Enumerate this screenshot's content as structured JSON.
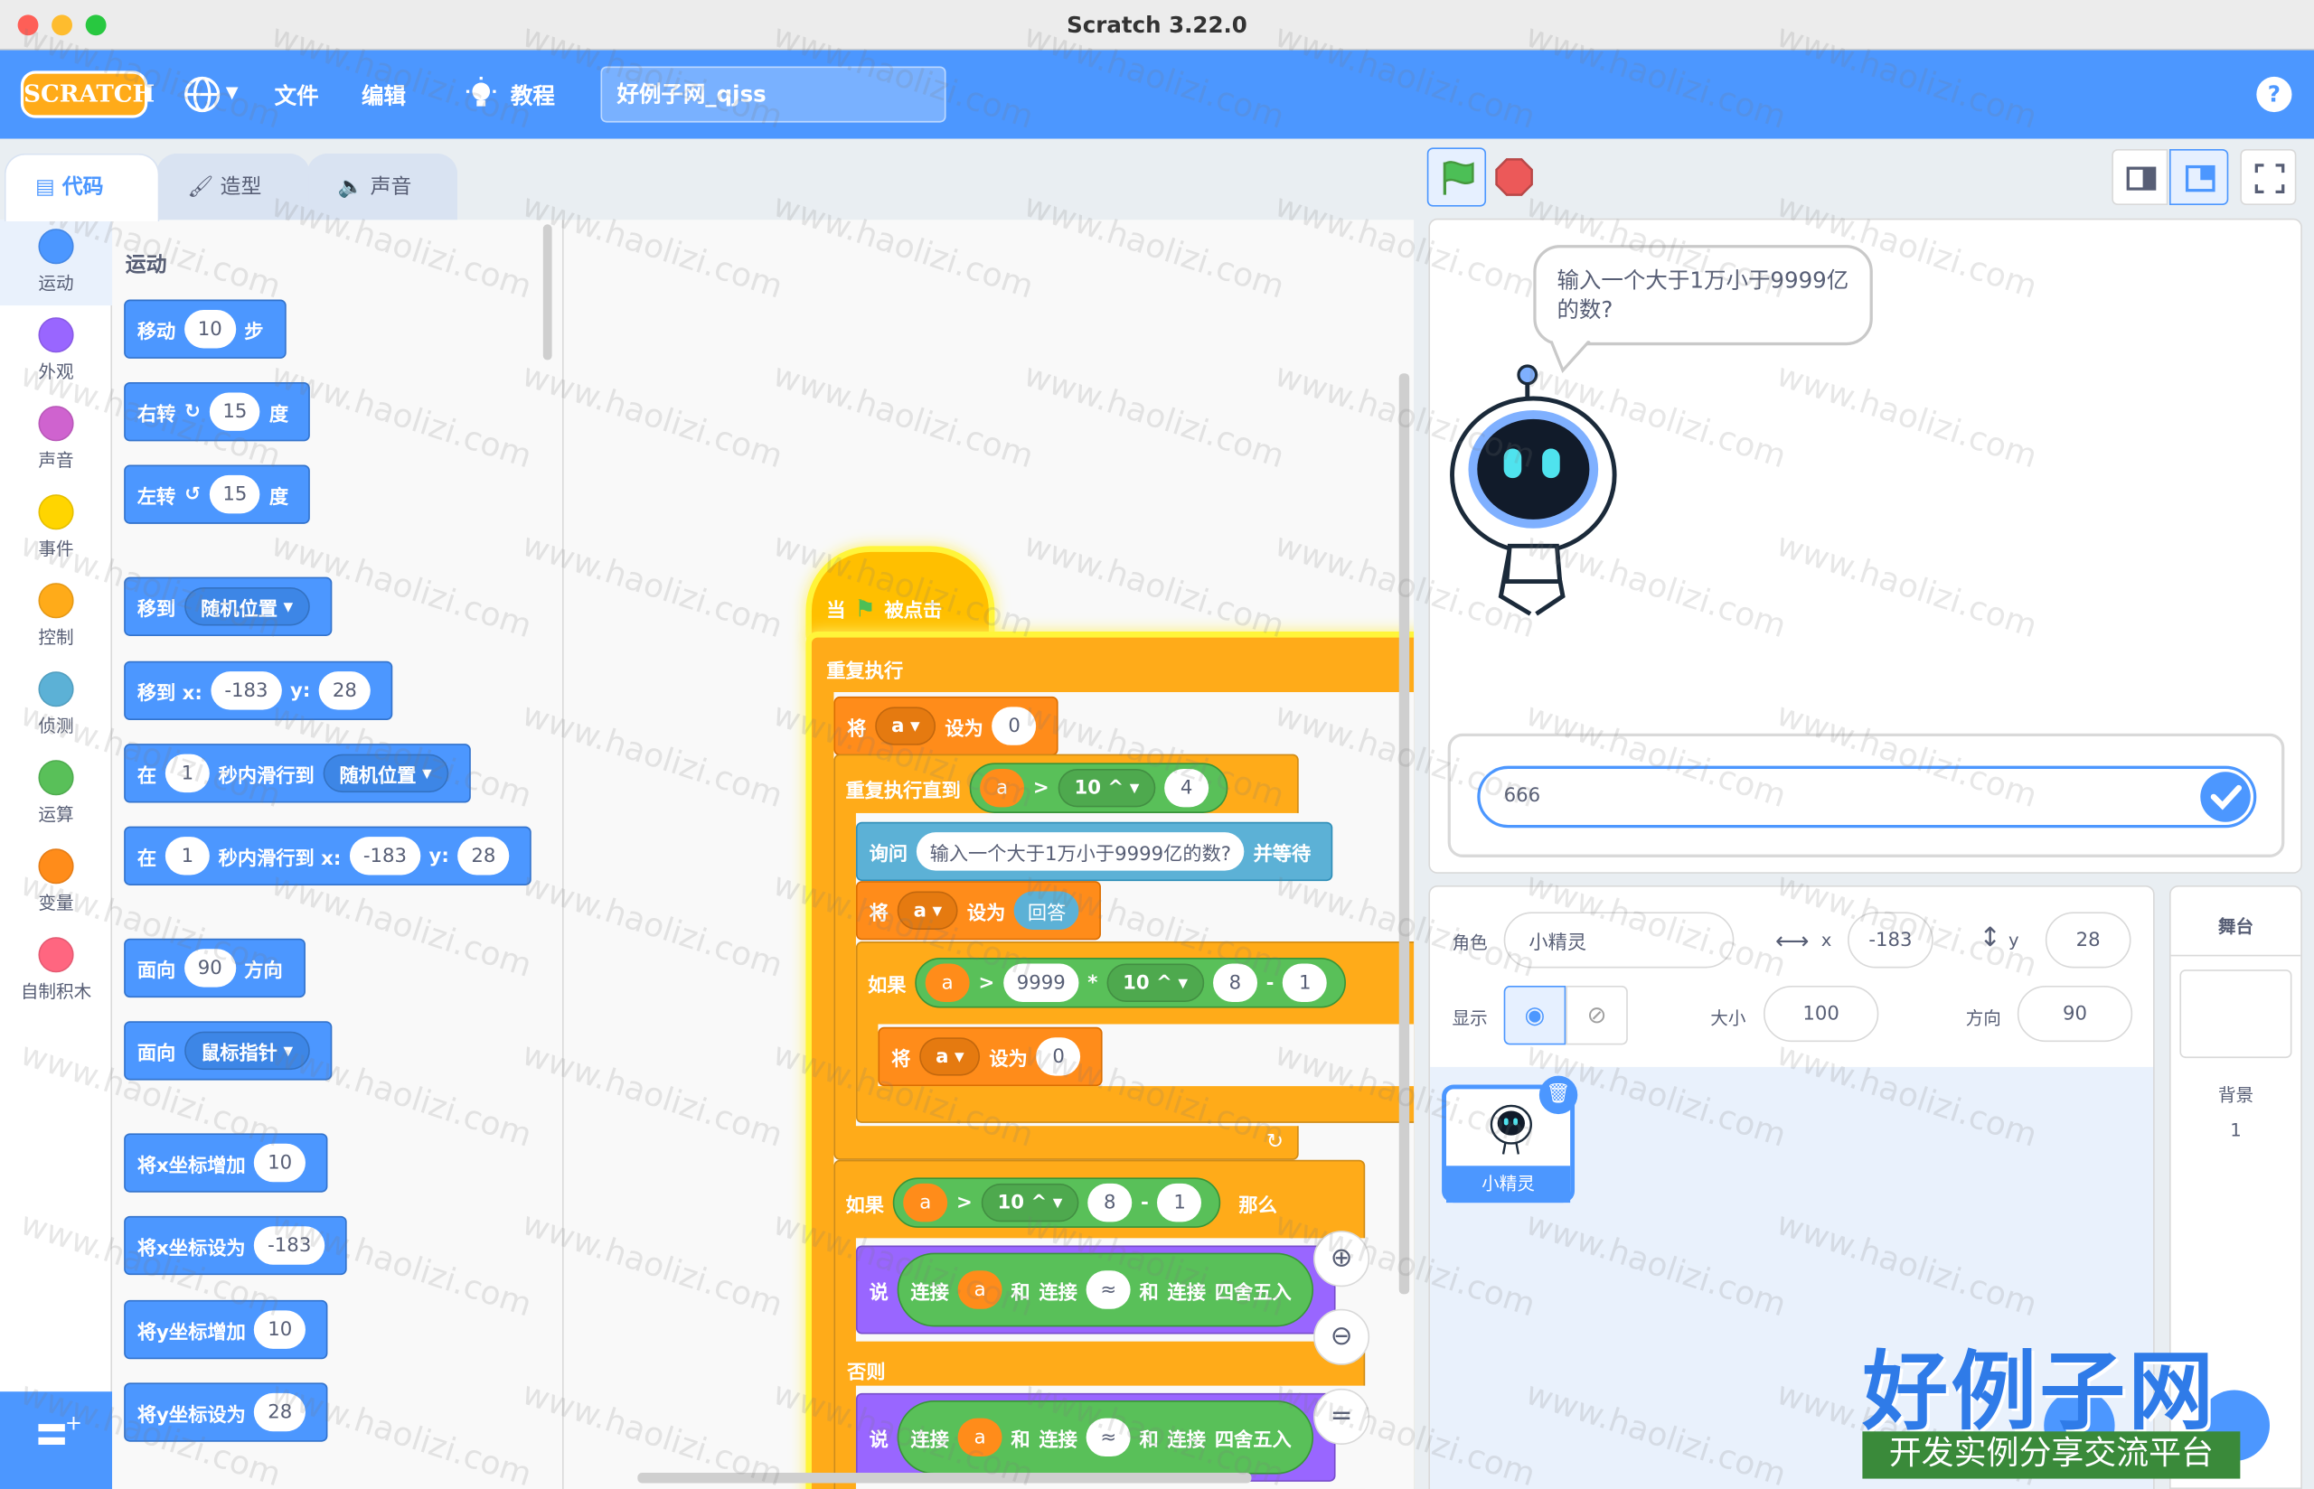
{
  "window": {
    "title": "Scratch 3.22.0"
  },
  "menubar": {
    "logo": "SCRATCH",
    "language_icon": "globe-icon",
    "file": "文件",
    "edit": "编辑",
    "tutorials": "教程",
    "project_name": "好例子网_qjss",
    "help": "?"
  },
  "tabs": [
    {
      "label": "代码",
      "active": true
    },
    {
      "label": "造型",
      "active": false
    },
    {
      "label": "声音",
      "active": false
    }
  ],
  "categories": [
    {
      "label": "运动",
      "color": "#4c97ff"
    },
    {
      "label": "外观",
      "color": "#9966ff"
    },
    {
      "label": "声音",
      "color": "#cf63cf"
    },
    {
      "label": "事件",
      "color": "#ffd500"
    },
    {
      "label": "控制",
      "color": "#ffab19"
    },
    {
      "label": "侦测",
      "color": "#5cb1d6"
    },
    {
      "label": "运算",
      "color": "#59c059"
    },
    {
      "label": "变量",
      "color": "#ff8c1a"
    },
    {
      "label": "自制积木",
      "color": "#ff6680"
    }
  ],
  "palette": {
    "heading": "运动",
    "move": {
      "a": "移动",
      "v": "10",
      "b": "步"
    },
    "turn_right": {
      "a": "右转",
      "v": "15",
      "b": "度"
    },
    "turn_left": {
      "a": "左转",
      "v": "15",
      "b": "度"
    },
    "goto": {
      "a": "移到",
      "v": "随机位置"
    },
    "goto_xy": {
      "a": "移到 x:",
      "x": "-183",
      "b": "y:",
      "y": "28"
    },
    "glide": {
      "a": "在",
      "v": "1",
      "b": "秒内滑行到",
      "d": "随机位置"
    },
    "glide_xy": {
      "a": "在",
      "v": "1",
      "b": "秒内滑行到 x:",
      "x": "-183",
      "c": "y:",
      "y": "28"
    },
    "point_dir": {
      "a": "面向",
      "v": "90",
      "b": "方向"
    },
    "point_towards": {
      "a": "面向",
      "v": "鼠标指针"
    },
    "change_x": {
      "a": "将x坐标增加",
      "v": "10"
    },
    "set_x": {
      "a": "将x坐标设为",
      "v": "-183"
    },
    "change_y": {
      "a": "将y坐标增加",
      "v": "10"
    },
    "set_y": {
      "a": "将y坐标设为",
      "v": "28"
    }
  },
  "script": {
    "hat": {
      "a": "当",
      "b": "被点击"
    },
    "forever": "重复执行",
    "set1": {
      "a": "将",
      "var": "a",
      "b": "设为",
      "v": "0"
    },
    "repeat_until": {
      "a": "重复执行直到",
      "var": "a",
      "op": ">",
      "p": "10 ^",
      "v": "4"
    },
    "ask": {
      "a": "询问",
      "q": "输入一个大于1万小于9999亿的数?",
      "b": "并等待"
    },
    "set2": {
      "a": "将",
      "var": "a",
      "b": "设为",
      "v": "回答"
    },
    "if1": {
      "a": "如果",
      "var": "a",
      "op": ">",
      "v1": "9999",
      "mul": "*",
      "p": "10 ^",
      "v2": "8",
      "minus": "-",
      "v3": "1"
    },
    "set3": {
      "a": "将",
      "var": "a",
      "b": "设为",
      "v": "0"
    },
    "if2": {
      "a": "如果",
      "var": "a",
      "op": ">",
      "p": "10 ^",
      "v2": "8",
      "minus": "-",
      "v3": "1",
      "then": "那么"
    },
    "say1": {
      "a": "说",
      "j1": "连接",
      "var": "a",
      "and1": "和",
      "j2": "连接",
      "approx": "≈",
      "and2": "和",
      "j3": "连接",
      "round": "四舍五入"
    },
    "else": "否则",
    "say2": {
      "a": "说",
      "j1": "连接",
      "var": "a",
      "and1": "和",
      "j2": "连接",
      "approx": "≈",
      "and2": "和",
      "j3": "连接",
      "round": "四舍五入"
    }
  },
  "stage": {
    "bubble": "输入一个大于1万小于9999亿的数?",
    "answer": "666"
  },
  "sprite_info": {
    "sprite_label": "角色",
    "name": "小精灵",
    "x_label": "x",
    "x": "-183",
    "y_label": "y",
    "y": "28",
    "show_label": "显示",
    "size_label": "大小",
    "size": "100",
    "dir_label": "方向",
    "dir": "90"
  },
  "sprites": [
    {
      "name": "小精灵",
      "selected": true
    }
  ],
  "stage_panel": {
    "title": "舞台",
    "backdrop_label": "背景",
    "backdrop_count": "1"
  },
  "watermark": {
    "text": "www.haolizi.com",
    "brand": "好例子网",
    "brand_sub": "开发实例分享交流平台"
  },
  "colors": {
    "accent": "#4c97ff",
    "control": "#ffab19",
    "operators": "#59c059",
    "variables": "#ff8c1a"
  }
}
